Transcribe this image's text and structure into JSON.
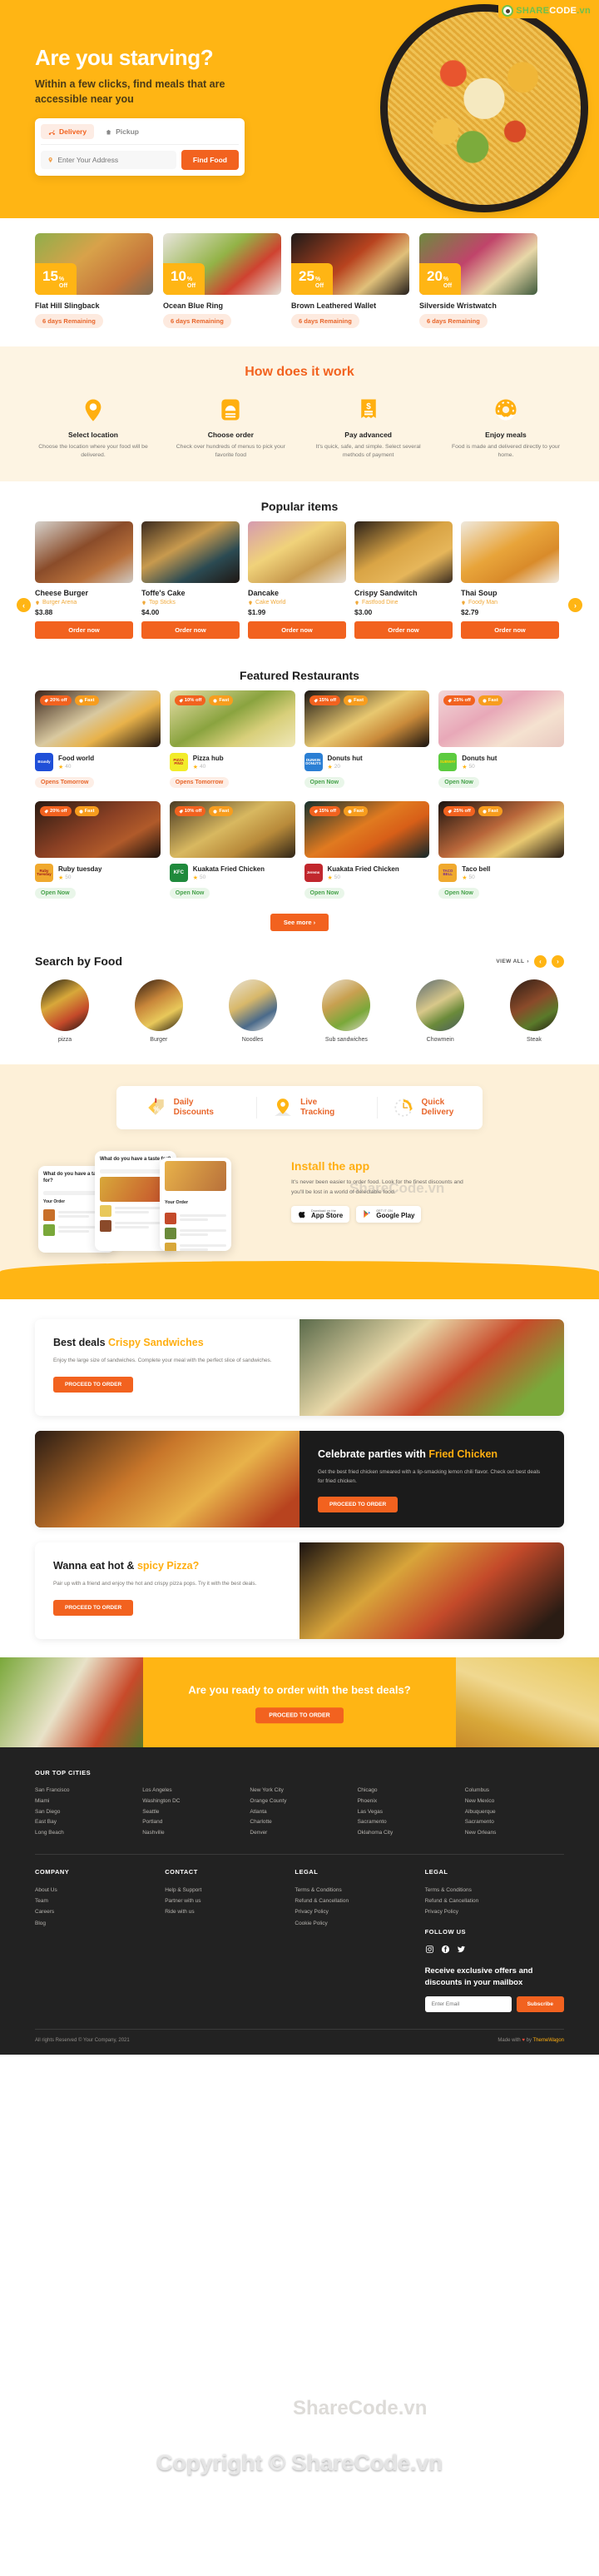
{
  "watermark": {
    "logo_share": "SHARE",
    "logo_code": "CODE",
    "logo_vn": ".vn",
    "mid": "ShareCode.vn",
    "copyright": "Copyright © ShareCode.vn"
  },
  "hero": {
    "title": "Are you starving?",
    "subtitle": "Within a few clicks, find meals that are accessible near you",
    "tabs": [
      {
        "label": "Delivery",
        "icon": "scooter-icon",
        "active": true
      },
      {
        "label": "Pickup",
        "icon": "bag-icon",
        "active": false
      }
    ],
    "address_placeholder": "Enter Your Address",
    "address_value": "",
    "find_button": "Find Food"
  },
  "deals": [
    {
      "percent": "15",
      "pct_sign": "%",
      "off": "Off",
      "title": "Flat Hill Slingback",
      "remaining": "6 days Remaining"
    },
    {
      "percent": "10",
      "pct_sign": "%",
      "off": "Off",
      "title": "Ocean Blue Ring",
      "remaining": "6 days Remaining"
    },
    {
      "percent": "25",
      "pct_sign": "%",
      "off": "Off",
      "title": "Brown Leathered Wallet",
      "remaining": "6 days Remaining"
    },
    {
      "percent": "20",
      "pct_sign": "%",
      "off": "Off",
      "title": "Silverside Wristwatch",
      "remaining": "6 days Remaining"
    }
  ],
  "how": {
    "title": "How does it work",
    "steps": [
      {
        "icon": "location-pin-icon",
        "title": "Select location",
        "text": "Choose the location where your food will be delivered."
      },
      {
        "icon": "food-cover-icon",
        "title": "Choose order",
        "text": "Check over hundreds of menus to pick your favorite food"
      },
      {
        "icon": "receipt-dollar-icon",
        "title": "Pay advanced",
        "text": "It's quick, safe, and simple. Select several methods of payment"
      },
      {
        "icon": "donut-icon",
        "title": "Enjoy meals",
        "text": "Food is made and delivered directly to your home."
      }
    ]
  },
  "popular": {
    "title": "Popular items",
    "items": [
      {
        "name": "Cheese Burger",
        "place": "Burger Arena",
        "price": "$3.88",
        "button": "Order now"
      },
      {
        "name": "Toffe's Cake",
        "place": "Top Sticks",
        "price": "$4.00",
        "button": "Order now"
      },
      {
        "name": "Dancake",
        "place": "Cake World",
        "price": "$1.99",
        "button": "Order now"
      },
      {
        "name": "Crispy Sandwitch",
        "place": "Fastfood Dine",
        "price": "$3.00",
        "button": "Order now"
      },
      {
        "name": "Thai Soup",
        "place": "Foody Man",
        "price": "$2.79",
        "button": "Order now"
      }
    ],
    "prev": "‹",
    "next": "›"
  },
  "featured": {
    "title": "Featured Restaurants",
    "see_more": "See more  ›",
    "restaurants": [
      {
        "name": "Food world",
        "rating": "40",
        "status": "Opens Tomorrow",
        "status_type": "tmr",
        "discount": "20% off",
        "fast": "Fast",
        "logo_text": "Brandy",
        "logo_bg": "#1f4fd8",
        "logo_color": "#ffffff"
      },
      {
        "name": "Pizza hub",
        "rating": "40",
        "status": "Opens Tomorrow",
        "status_type": "tmr",
        "discount": "10% off",
        "fast": "Fast",
        "logo_text": "PIZZA PINO",
        "logo_bg": "#f2ec2a",
        "logo_color": "#c22121"
      },
      {
        "name": "Donuts hut",
        "rating": "20",
        "status": "Open Now",
        "status_type": "open",
        "discount": "15% off",
        "fast": "Fast",
        "logo_text": "DUNKIN DONUTS",
        "logo_bg": "#2b7fd4",
        "logo_color": "#ffffff"
      },
      {
        "name": "Donuts hut",
        "rating": "50",
        "status": "Open Now",
        "status_type": "open",
        "discount": "25% off",
        "fast": "Fast",
        "logo_text": "SUBWAY",
        "logo_bg": "#5ccb3f",
        "logo_color": "#ffd400"
      },
      {
        "name": "Ruby tuesday",
        "rating": "50",
        "status": "Open Now",
        "status_type": "open",
        "discount": "20% off",
        "fast": "Fast",
        "logo_text": "Ruby Tuesday",
        "logo_bg": "#f0a92e",
        "logo_color": "#a01c1c"
      },
      {
        "name": "Kuakata Fried Chicken",
        "rating": "50",
        "status": "Open Now",
        "status_type": "open",
        "discount": "10% off",
        "fast": "Fast",
        "logo_text": "KFC",
        "logo_bg": "#1f8a3c",
        "logo_color": "#ffffff"
      },
      {
        "name": "Kuakata Fried Chicken",
        "rating": "50",
        "status": "Open Now",
        "status_type": "open",
        "discount": "15% off",
        "fast": "Fast",
        "logo_text": "Jerems",
        "logo_bg": "#c1272d",
        "logo_color": "#ffffff"
      },
      {
        "name": "Taco bell",
        "rating": "50",
        "status": "Open Now",
        "status_type": "open",
        "discount": "25% off",
        "fast": "Fast",
        "logo_text": "TACO BELL",
        "logo_bg": "#f0a92e",
        "logo_color": "#7b2d8e"
      }
    ]
  },
  "search_by_food": {
    "title": "Search by Food",
    "view_all": "VIEW ALL",
    "prev": "‹",
    "next": "›",
    "items": [
      {
        "label": "pizza"
      },
      {
        "label": "Burger"
      },
      {
        "label": "Noodles"
      },
      {
        "label": "Sub sandwiches"
      },
      {
        "label": "Chowmein"
      },
      {
        "label": "Steak"
      }
    ]
  },
  "features": [
    {
      "icon": "discount-tag-icon",
      "line1": "Daily",
      "line2": "Discounts"
    },
    {
      "icon": "location-pin-icon",
      "line1": "Live",
      "line2": "Tracking"
    },
    {
      "icon": "clock-fast-icon",
      "line1": "Quick",
      "line2": "Delivery"
    }
  ],
  "app": {
    "title": "Install the app",
    "text": "It's never been easier to order food. Look for the finest discounts and you'll be lost in a world of delectable food.",
    "stores": [
      {
        "sub": "Download on the",
        "main": "App Store",
        "icon": "apple-icon"
      },
      {
        "sub": "GET IT ON",
        "main": "Google Play",
        "icon": "google-play-icon"
      }
    ],
    "phone_texts": {
      "p1": "What do you have a taste for?",
      "p1_sub": "Your Order",
      "p2": "What do you have a taste for?",
      "p3": "Your Order"
    }
  },
  "promos": [
    {
      "title_plain": "Best deals ",
      "title_accent": "Crispy Sandwiches",
      "text": "Enjoy the large size of sandwiches. Complete your meal with the perfect slice of sandwiches.",
      "button": "PROCEED TO ORDER",
      "dark": false,
      "reverse": false
    },
    {
      "title_plain": "Celebrate parties with ",
      "title_accent": "Fried Chicken",
      "text": "Get the best fried chicken smeared with a lip-smacking lemon chili flavor. Check out best deals for fried chicken.",
      "button": "PROCEED TO ORDER",
      "dark": true,
      "reverse": true
    },
    {
      "title_plain": "Wanna eat hot & ",
      "title_accent": "spicy Pizza?",
      "text": "Pair up with a friend and enjoy the hot and crispy pizza pops. Try it with the best deals.",
      "button": "PROCEED TO ORDER",
      "dark": false,
      "reverse": false
    }
  ],
  "cta": {
    "title": "Are you ready to order with the best deals?",
    "button": "PROCEED TO ORDER"
  },
  "footer": {
    "cities_head": "OUR TOP CITIES",
    "cities": [
      "San Francisco",
      "Los Angeles",
      "New York City",
      "Chicago",
      "Columbus",
      "Miami",
      "Washington DC",
      "Orange County",
      "Phoenix",
      "New Mexico",
      "San Diego",
      "Seattle",
      "Atlanta",
      "Las Vegas",
      "Albuquerque",
      "East Bay",
      "Portland",
      "Charlotte",
      "Sacramento",
      "Sacramento",
      "Long Beach",
      "Nashville",
      "Denver",
      "Oklahoma City",
      "New Orleans"
    ],
    "columns": [
      {
        "head": "COMPANY",
        "links": [
          "About Us",
          "Team",
          "Careers",
          "Blog"
        ]
      },
      {
        "head": "CONTACT",
        "links": [
          "Help & Support",
          "Partner with us",
          "Ride with us"
        ]
      },
      {
        "head": "LEGAL",
        "links": [
          "Terms & Conditions",
          "Refund & Cancellation",
          "Privacy Policy",
          "Cookie Policy"
        ]
      },
      {
        "head": "LEGAL",
        "links": [
          "Terms & Conditions",
          "Refund & Cancellation",
          "Privacy Policy"
        ]
      }
    ],
    "follow_head": "FOLLOW US",
    "socials": [
      "instagram-icon",
      "facebook-icon",
      "twitter-icon"
    ],
    "news_title": "Receive exclusive offers and discounts in your mailbox",
    "news_placeholder": "Enter Email",
    "news_value": "",
    "news_button": "Subscribe",
    "copyright": "All rights Reserved © Your Company, 2021",
    "made_by_pre": "Made with ",
    "made_by_heart": "♥",
    "made_by_post": " by ",
    "made_by_brand": "ThemeWagon"
  }
}
